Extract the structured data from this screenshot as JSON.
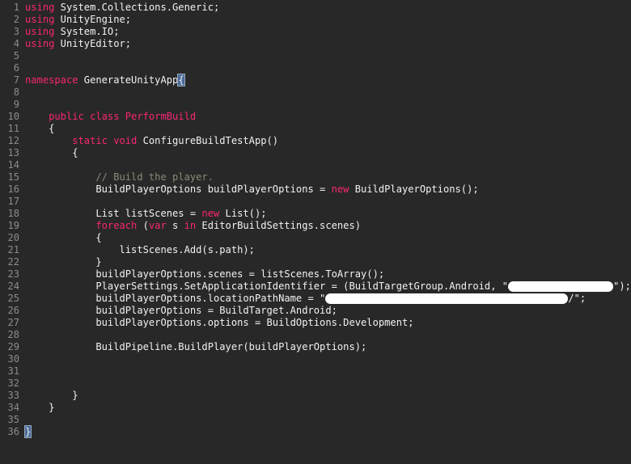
{
  "editor": {
    "lines": [
      {
        "n": "1",
        "tokens": [
          [
            "kw",
            "using"
          ],
          [
            "t",
            " System.Collections.Generic;"
          ]
        ]
      },
      {
        "n": "2",
        "tokens": [
          [
            "kw",
            "using"
          ],
          [
            "t",
            " UnityEngine;"
          ]
        ]
      },
      {
        "n": "3",
        "tokens": [
          [
            "kw",
            "using"
          ],
          [
            "t",
            " System.IO;"
          ]
        ]
      },
      {
        "n": "4",
        "tokens": [
          [
            "kw",
            "using"
          ],
          [
            "t",
            " UnityEditor;"
          ]
        ]
      },
      {
        "n": "5",
        "tokens": []
      },
      {
        "n": "6",
        "tokens": []
      },
      {
        "n": "7",
        "tokens": [
          [
            "kw",
            "namespace"
          ],
          [
            "t",
            " GenerateUnityApp"
          ],
          [
            "hl",
            "{"
          ]
        ]
      },
      {
        "n": "8",
        "tokens": []
      },
      {
        "n": "9",
        "tokens": []
      },
      {
        "n": "10",
        "tokens": [
          [
            "t",
            "    "
          ],
          [
            "kw",
            "public"
          ],
          [
            "t",
            " "
          ],
          [
            "kw",
            "class"
          ],
          [
            "t",
            " "
          ],
          [
            "kw",
            "PerformBuild"
          ]
        ]
      },
      {
        "n": "11",
        "tokens": [
          [
            "t",
            "    {"
          ]
        ]
      },
      {
        "n": "12",
        "tokens": [
          [
            "t",
            "        "
          ],
          [
            "kw",
            "static"
          ],
          [
            "t",
            " "
          ],
          [
            "kw",
            "void"
          ],
          [
            "t",
            " ConfigureBuildTestApp()"
          ]
        ]
      },
      {
        "n": "13",
        "tokens": [
          [
            "t",
            "        {"
          ]
        ]
      },
      {
        "n": "14",
        "tokens": []
      },
      {
        "n": "15",
        "tokens": [
          [
            "t",
            "            "
          ],
          [
            "cm",
            "// Build the player."
          ]
        ]
      },
      {
        "n": "16",
        "tokens": [
          [
            "t",
            "            BuildPlayerOptions buildPlayerOptions = "
          ],
          [
            "kw",
            "new"
          ],
          [
            "t",
            " BuildPlayerOptions();"
          ]
        ]
      },
      {
        "n": "17",
        "tokens": []
      },
      {
        "n": "18",
        "tokens": [
          [
            "t",
            "            List listScenes = "
          ],
          [
            "kw",
            "new"
          ],
          [
            "t",
            " List();"
          ]
        ]
      },
      {
        "n": "19",
        "tokens": [
          [
            "t",
            "            "
          ],
          [
            "kw",
            "foreach"
          ],
          [
            "t",
            " ("
          ],
          [
            "kw",
            "var"
          ],
          [
            "t",
            " s "
          ],
          [
            "kw",
            "in"
          ],
          [
            "t",
            " EditorBuildSettings.scenes)"
          ]
        ]
      },
      {
        "n": "20",
        "tokens": [
          [
            "t",
            "            {"
          ]
        ]
      },
      {
        "n": "21",
        "tokens": [
          [
            "t",
            "                listScenes.Add(s.path);"
          ]
        ]
      },
      {
        "n": "22",
        "tokens": [
          [
            "t",
            "            }"
          ]
        ]
      },
      {
        "n": "23",
        "tokens": [
          [
            "t",
            "            buildPlayerOptions.scenes = listScenes.ToArray();"
          ]
        ]
      },
      {
        "n": "24",
        "tokens": [
          [
            "t",
            "            PlayerSettings.SetApplicationIdentifier = (BuildTargetGroup.Android, \""
          ],
          [
            "redact",
            "130"
          ],
          [
            "t",
            "\");"
          ]
        ]
      },
      {
        "n": "25",
        "tokens": [
          [
            "t",
            "            buildPlayerOptions.locationPathName = \""
          ],
          [
            "redact",
            "300"
          ],
          [
            "t",
            "/\";"
          ]
        ]
      },
      {
        "n": "26",
        "tokens": [
          [
            "t",
            "            buildPlayerOptions = BuildTarget.Android;"
          ]
        ]
      },
      {
        "n": "27",
        "tokens": [
          [
            "t",
            "            buildPlayerOptions.options = BuildOptions.Development;"
          ]
        ]
      },
      {
        "n": "28",
        "tokens": []
      },
      {
        "n": "29",
        "tokens": [
          [
            "t",
            "            BuildPipeline.BuildPlayer(buildPlayerOptions);"
          ]
        ]
      },
      {
        "n": "30",
        "tokens": []
      },
      {
        "n": "31",
        "tokens": []
      },
      {
        "n": "32",
        "tokens": []
      },
      {
        "n": "33",
        "tokens": [
          [
            "t",
            "        }"
          ]
        ]
      },
      {
        "n": "34",
        "tokens": [
          [
            "t",
            "    }"
          ]
        ]
      },
      {
        "n": "35",
        "tokens": []
      },
      {
        "n": "36",
        "tokens": [
          [
            "hl",
            "}"
          ]
        ]
      }
    ]
  }
}
